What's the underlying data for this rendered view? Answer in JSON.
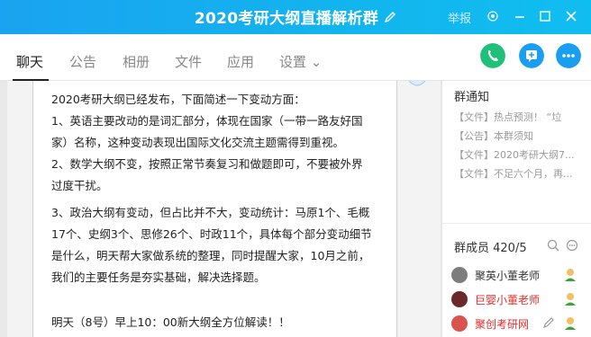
{
  "window": {
    "title": "2020考研大纲直播解析群",
    "report_label": "举报"
  },
  "tabs": [
    {
      "label": "聊天"
    },
    {
      "label": "公告"
    },
    {
      "label": "相册"
    },
    {
      "label": "文件"
    },
    {
      "label": "应用"
    },
    {
      "label": "设置 ⌄"
    }
  ],
  "message": {
    "lines": [
      "2020考研大纲已经发布，下面简述一下变动方面：",
      "1、英语主要改动的是词汇部分，体现在国家（一带一路友好国",
      "家）名称，这种变动表现出国际文化交流主题需得到重视。",
      "2、数学大纲不变，按照正常节奏复习和做题即可，不要被外界",
      "过度干扰。",
      "3、政治大纲有变动，但占比并不大，变动统计：马原1个、毛概",
      "17个、史纲3个、思修26个、时政11个，具体每个部分变动细节",
      "是什么，明天帮大家做系统的整理，同时提醒大家，10月之前，",
      "我们的主要任务是夯实基础，解决选择题。",
      "明天（8号）早上10：00新大纲全方位解读！！"
    ]
  },
  "right_panel": {
    "notice_title": "群通知",
    "notices": [
      "【文件】热点预测！ “垃",
      "【公告】本群须知",
      "【文件】2020考研大纲7...",
      "【文件】不足六个月，再..."
    ],
    "members_title": "群成员 420/5",
    "members": [
      {
        "name": "聚英小董老师",
        "color": "#333333"
      },
      {
        "name": "巨婴小董老师",
        "color": "#e0302c"
      },
      {
        "name": "聚创考研网",
        "color": "#e0302c"
      }
    ]
  },
  "colors": {
    "titlebar": "#1aa3f0",
    "call_button": "#20c07a",
    "action_button": "#1a9ef0"
  }
}
